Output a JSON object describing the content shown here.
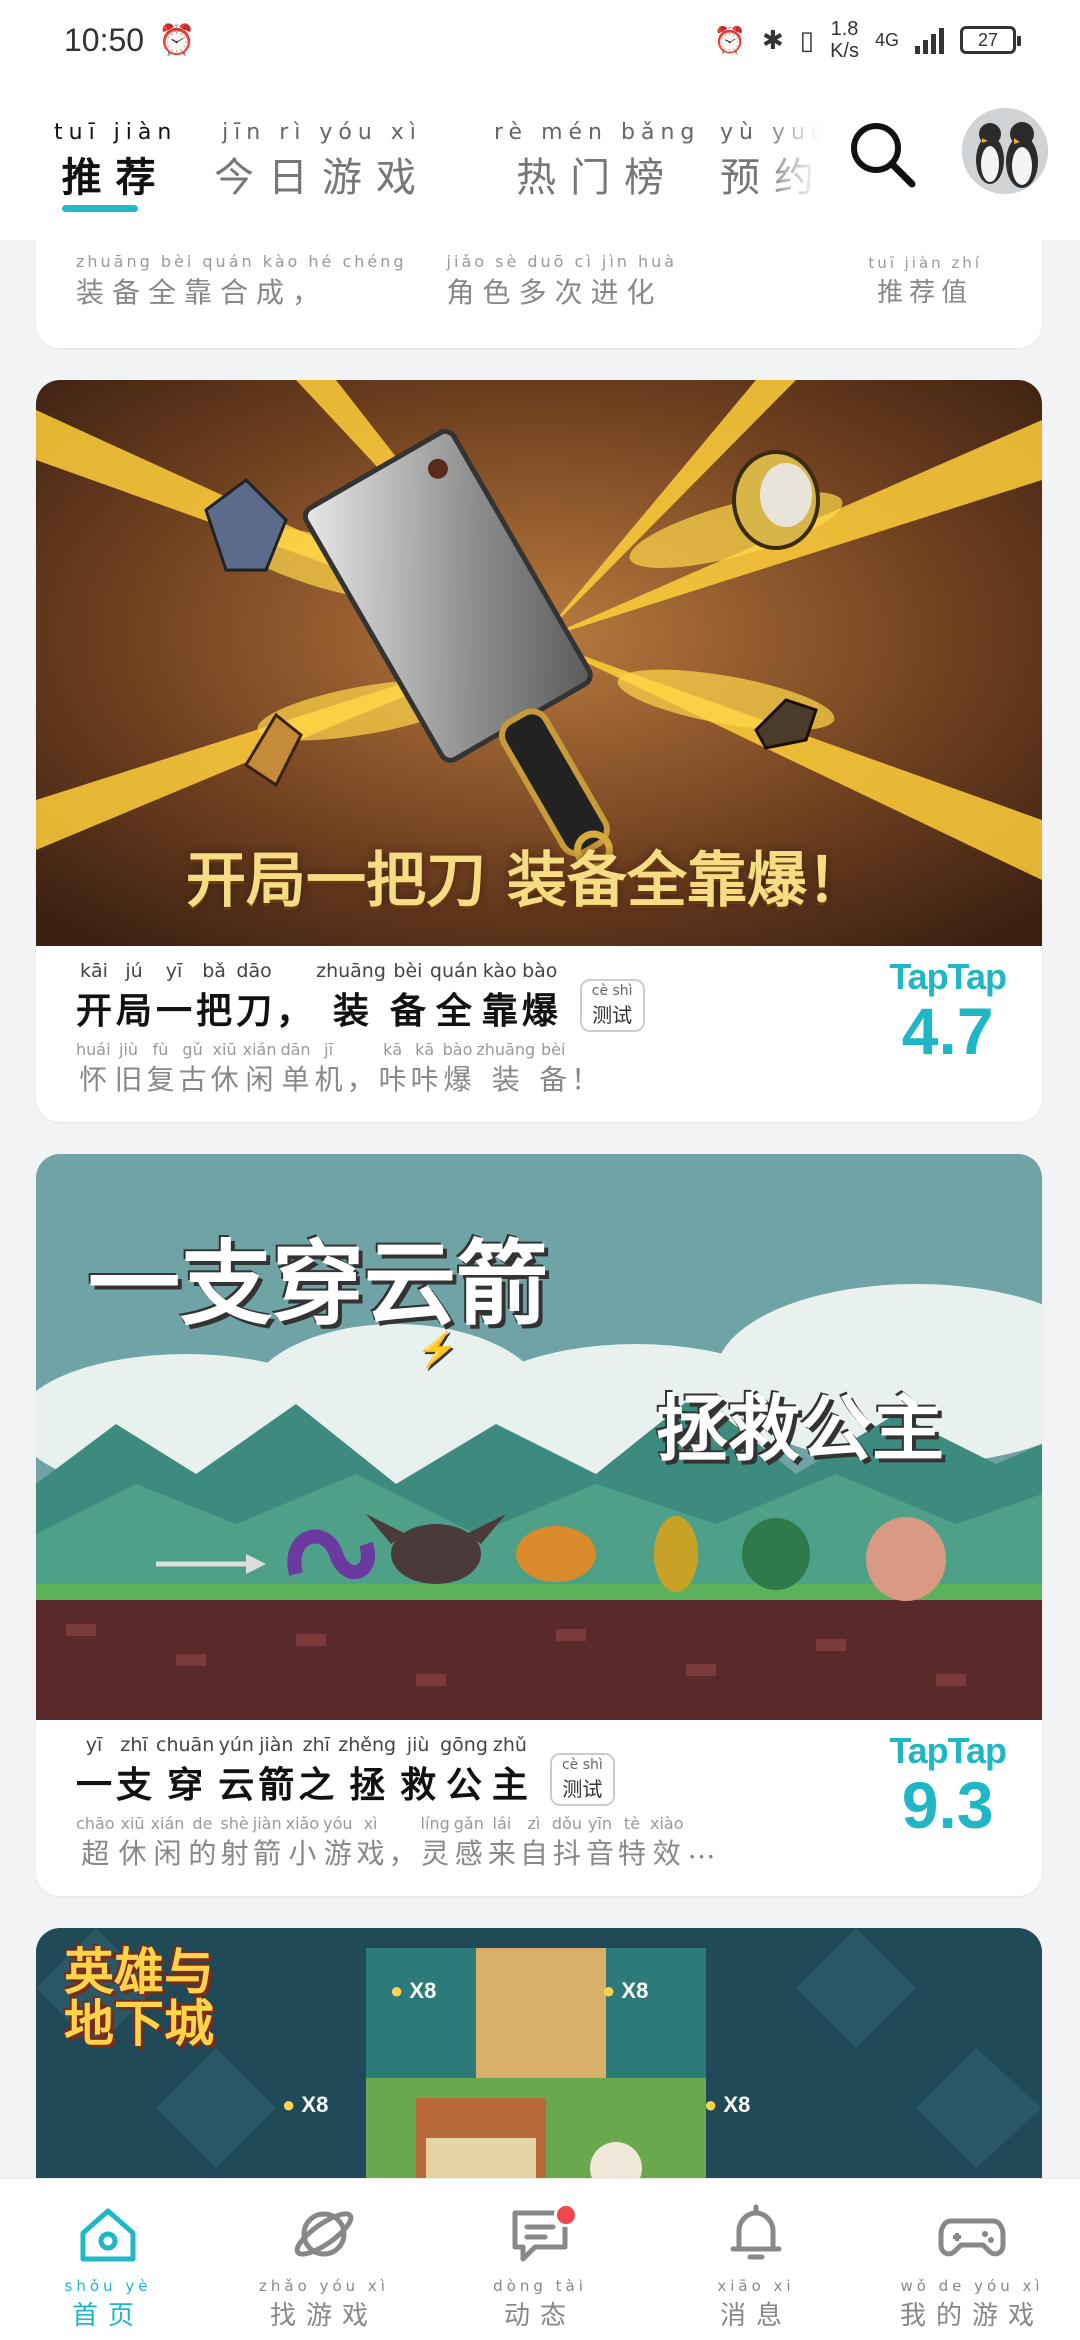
{
  "status_bar": {
    "time": "10:50",
    "net_speed_value": "1.8",
    "net_speed_unit": "K/s",
    "network": "4G",
    "battery": "27"
  },
  "top_tabs": [
    {
      "pinyin": "tuī jiàn",
      "label": "推荐",
      "active": true
    },
    {
      "pinyin": "jīn rì yóu xì",
      "label": "今日游戏",
      "active": false
    },
    {
      "pinyin": "rè mén bǎng",
      "label": "热门榜",
      "active": false
    },
    {
      "pinyin": "yù yuē",
      "label": "预约",
      "active": false
    }
  ],
  "partial_card": {
    "subtitle_pinyin": [
      "zhuāng bèi quán kào hé chéng",
      "jiǎo sè duō cì jìn huà"
    ],
    "subtitle": [
      "装备全靠合成，",
      "角色多次进化"
    ],
    "rating_label_pinyin": "tuī jiàn zhí",
    "rating_label": "推荐值"
  },
  "cards": [
    {
      "banner_text": "开局一把刀 装备全靠爆！",
      "title_words": [
        {
          "py": "kāi",
          "hz": "开"
        },
        {
          "py": "jú",
          "hz": "局"
        },
        {
          "py": "yī",
          "hz": "一"
        },
        {
          "py": "bǎ",
          "hz": "把"
        },
        {
          "py": "dāo",
          "hz": "刀"
        },
        {
          "py": "",
          "hz": "，"
        },
        {
          "py": "zhuāng",
          "hz": "装"
        },
        {
          "py": "bèi",
          "hz": "备"
        },
        {
          "py": "quán",
          "hz": "全"
        },
        {
          "py": "kào",
          "hz": "靠"
        },
        {
          "py": "bào",
          "hz": "爆"
        }
      ],
      "tag_pinyin": "cè shì",
      "tag": "测试",
      "subtitle_words": [
        {
          "py": "huái",
          "hz": "怀"
        },
        {
          "py": "jiù",
          "hz": "旧"
        },
        {
          "py": "fù",
          "hz": "复"
        },
        {
          "py": "gǔ",
          "hz": "古"
        },
        {
          "py": "xiū",
          "hz": "休"
        },
        {
          "py": "xián",
          "hz": "闲"
        },
        {
          "py": "dān",
          "hz": "单"
        },
        {
          "py": "jī",
          "hz": "机"
        },
        {
          "py": "",
          "hz": "，"
        },
        {
          "py": "kā",
          "hz": "咔"
        },
        {
          "py": "kā",
          "hz": "咔"
        },
        {
          "py": "bào",
          "hz": "爆"
        },
        {
          "py": "zhuāng",
          "hz": "装"
        },
        {
          "py": "bèi",
          "hz": "备"
        },
        {
          "py": "",
          "hz": "！"
        }
      ],
      "rating_brand": "TapTap",
      "rating": "4.7"
    },
    {
      "banner_text_1": "一支穿云箭",
      "banner_text_2": "拯救公主",
      "title_words": [
        {
          "py": "yī",
          "hz": "一"
        },
        {
          "py": "zhī",
          "hz": "支"
        },
        {
          "py": "chuān",
          "hz": "穿"
        },
        {
          "py": "yún",
          "hz": "云"
        },
        {
          "py": "jiàn",
          "hz": "箭"
        },
        {
          "py": "zhī",
          "hz": "之"
        },
        {
          "py": "zhěng",
          "hz": "拯"
        },
        {
          "py": "jiù",
          "hz": "救"
        },
        {
          "py": "gōng",
          "hz": "公"
        },
        {
          "py": "zhǔ",
          "hz": "主"
        }
      ],
      "tag_pinyin": "cè shì",
      "tag": "测试",
      "subtitle_words": [
        {
          "py": "chāo",
          "hz": "超"
        },
        {
          "py": "xiū",
          "hz": "休"
        },
        {
          "py": "xián",
          "hz": "闲"
        },
        {
          "py": "de",
          "hz": "的"
        },
        {
          "py": "shè",
          "hz": "射"
        },
        {
          "py": "jiàn",
          "hz": "箭"
        },
        {
          "py": "xiǎo",
          "hz": "小"
        },
        {
          "py": "yóu",
          "hz": "游"
        },
        {
          "py": "xì",
          "hz": "戏"
        },
        {
          "py": "",
          "hz": "，"
        },
        {
          "py": "líng",
          "hz": "灵"
        },
        {
          "py": "gǎn",
          "hz": "感"
        },
        {
          "py": "lái",
          "hz": "来"
        },
        {
          "py": "zì",
          "hz": "自"
        },
        {
          "py": "dǒu",
          "hz": "抖"
        },
        {
          "py": "yīn",
          "hz": "音"
        },
        {
          "py": "tè",
          "hz": "特"
        },
        {
          "py": "xiào",
          "hz": "效"
        },
        {
          "py": "",
          "hz": "…"
        }
      ],
      "rating_brand": "TapTap",
      "rating": "9.3"
    },
    {
      "banner_logo": "英雄与地下城",
      "multipliers": [
        "X8",
        "X8",
        "X8",
        "X8"
      ]
    }
  ],
  "bottom_nav": [
    {
      "pinyin": "shǒu yè",
      "label": "首页",
      "icon": "home-icon",
      "active": true
    },
    {
      "pinyin": "zhǎo yóu xì",
      "label": "找游戏",
      "icon": "planet-icon",
      "active": false
    },
    {
      "pinyin": "dòng tài",
      "label": "动态",
      "icon": "chat-icon",
      "active": false,
      "badge": true
    },
    {
      "pinyin": "xiāo xi",
      "label": "消息",
      "icon": "bell-icon",
      "active": false
    },
    {
      "pinyin": "wǒ de yóu xì",
      "label": "我的游戏",
      "icon": "gamepad-icon",
      "active": false
    }
  ],
  "colors": {
    "accent": "#1fb7c5",
    "badge": "#f0474f",
    "page_bg": "#f2f3f5"
  }
}
